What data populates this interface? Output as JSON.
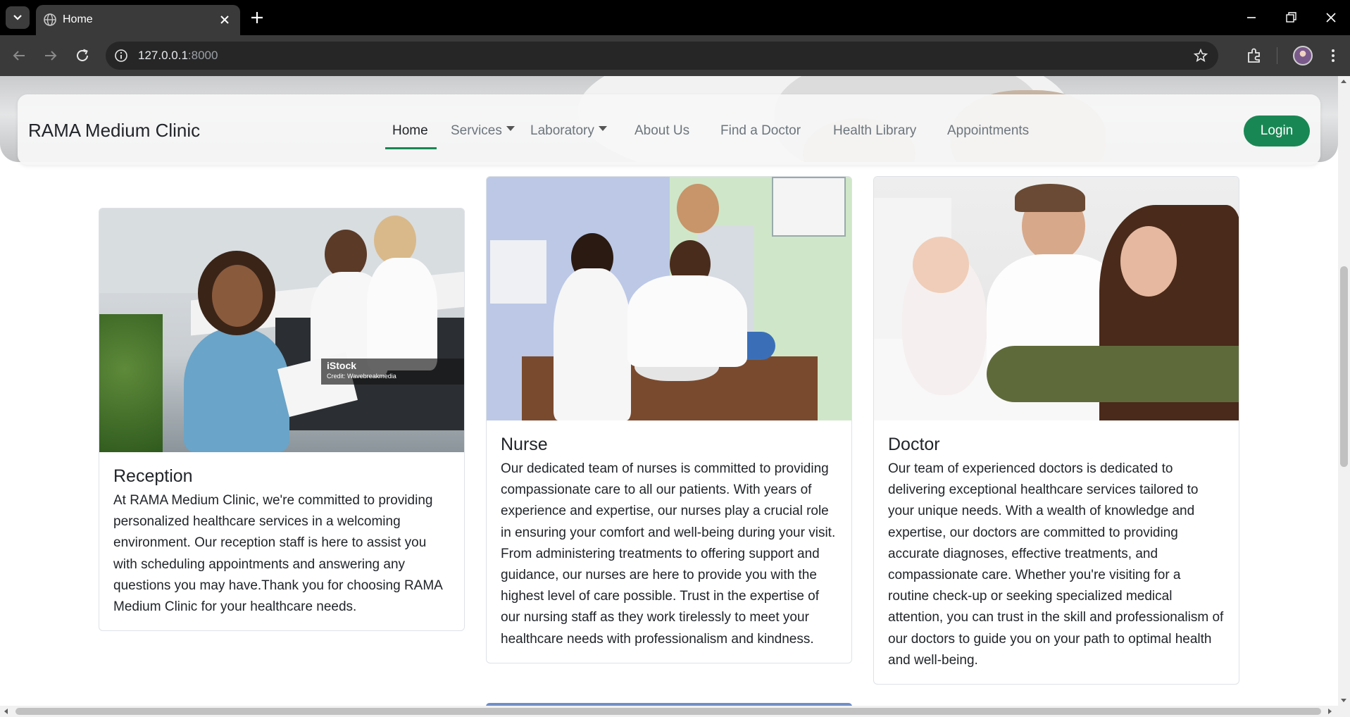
{
  "browser": {
    "tab_title": "Home",
    "url_host": "127.0.0.1",
    "url_port": ":8000"
  },
  "navbar": {
    "brand": "RAMA Medium Clinic",
    "items": [
      {
        "label": "Home",
        "active": true
      },
      {
        "label": "Services",
        "dropdown": true
      },
      {
        "label": "Laboratory",
        "dropdown": true
      },
      {
        "label": "About Us"
      },
      {
        "label": "Find a Doctor"
      },
      {
        "label": "Health Library"
      },
      {
        "label": "Appointments"
      }
    ],
    "login_label": "Login"
  },
  "cards": [
    {
      "title": "Reception",
      "text": "At RAMA Medium Clinic, we're committed to providing personalized healthcare services in a welcoming environment. Our reception staff is here to assist you with scheduling appointments and answering any questions you may have.Thank you for choosing RAMA Medium Clinic for your healthcare needs.",
      "watermark_brand": "iStock",
      "watermark_credit": "Credit: Wavebreakmedia"
    },
    {
      "title": "Nurse",
      "text": "Our dedicated team of nurses is committed to providing compassionate care to all our patients. With years of experience and expertise, our nurses play a crucial role in ensuring your comfort and well-being during your visit. From administering treatments to offering support and guidance, our nurses are here to provide you with the highest level of care possible. Trust in the expertise of our nursing staff as they work tirelessly to meet your healthcare needs with professionalism and kindness."
    },
    {
      "title": "Doctor",
      "text": "Our team of experienced doctors is dedicated to delivering exceptional healthcare services tailored to your unique needs. With a wealth of knowledge and expertise, our doctors are committed to providing accurate diagnoses, effective treatments, and compassionate care. Whether you're visiting for a routine check-up or seeking specialized medical attention, you can trust in the skill and professionalism of our doctors to guide you on your path to optimal health and well-being."
    }
  ],
  "colors": {
    "accent": "#198754",
    "text": "#212529",
    "muted": "#6c757d"
  }
}
